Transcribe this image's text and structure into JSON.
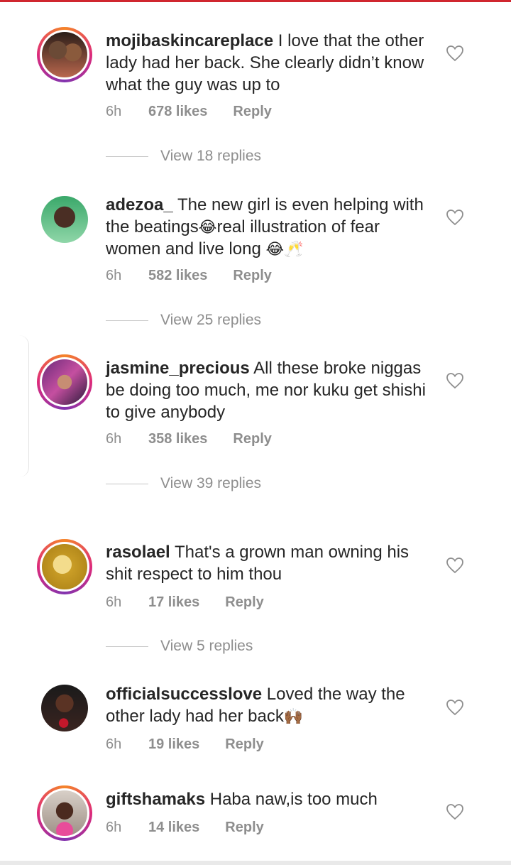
{
  "comments": [
    {
      "username": "mojibaskincareplace",
      "text": "I love that the other lady had her back. She clearly didn’t know what the guy was up to",
      "time": "6h",
      "likes": "678 likes",
      "reply": "Reply",
      "view_replies": "View 18 replies",
      "avatar_ring": true
    },
    {
      "username": "adezoa_",
      "text_a": "The new girl is even helping with the beatings",
      "emoji_a": "😂",
      "text_b": "real illustration of fear women and live long ",
      "emoji_b": "😂",
      "emoji_c": "🥂",
      "time": "6h",
      "likes": "582 likes",
      "reply": "Reply",
      "view_replies": "View 25 replies",
      "avatar_ring": false
    },
    {
      "username": "jasmine_precious",
      "text": "All these broke niggas be doing too much, me nor kuku get shishi to give anybody",
      "time": "6h",
      "likes": "358 likes",
      "reply": "Reply",
      "view_replies": "View 39 replies",
      "avatar_ring": true
    },
    {
      "username": "rasolael",
      "text": "That's a grown man owning his shit respect to him thou",
      "time": "6h",
      "likes": "17 likes",
      "reply": "Reply",
      "view_replies": "View 5 replies",
      "avatar_ring": true
    },
    {
      "username": "officialsuccesslove",
      "text": "Loved the way the other lady had her back",
      "emoji": "🙌🏾",
      "time": "6h",
      "likes": "19 likes",
      "reply": "Reply",
      "avatar_ring": false
    },
    {
      "username": "giftshamaks",
      "text": "Haba naw,is too much",
      "time": "6h",
      "likes": "14 likes",
      "reply": "Reply",
      "avatar_ring": true
    }
  ],
  "icons": {
    "heart": "heart-outline-icon"
  },
  "colors": {
    "top_bar": "#d0262f",
    "text": "#262626",
    "muted": "#8e8e8e"
  }
}
